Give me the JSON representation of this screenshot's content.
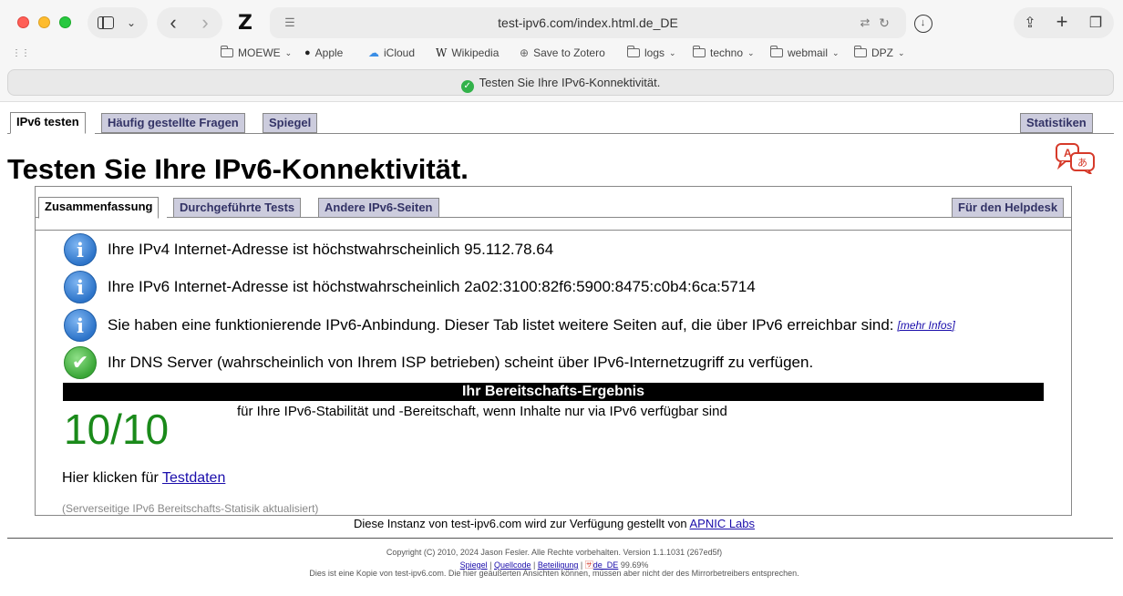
{
  "browser": {
    "url": "test-ipv6.com/index.html.de_DE",
    "tab_title": "Testen Sie Ihre IPv6-Konnektivität.",
    "bookmarks": [
      {
        "label": "MOEWE",
        "icon": "folder-icon",
        "dropdown": true
      },
      {
        "label": "Apple",
        "icon": "apple-icon",
        "dropdown": false
      },
      {
        "label": "iCloud",
        "icon": "cloud-icon",
        "dropdown": false
      },
      {
        "label": "Wikipedia",
        "icon": "wikipedia-icon",
        "dropdown": false
      },
      {
        "label": "Save to Zotero",
        "icon": "globe-icon",
        "dropdown": false
      },
      {
        "label": "logs",
        "icon": "folder-icon",
        "dropdown": true
      },
      {
        "label": "techno",
        "icon": "folder-icon",
        "dropdown": true
      },
      {
        "label": "webmail",
        "icon": "folder-icon",
        "dropdown": true
      },
      {
        "label": "DPZ",
        "icon": "folder-icon",
        "dropdown": true
      }
    ]
  },
  "page": {
    "top_tabs": [
      "IPv6 testen",
      "Häufig gestellte Fragen",
      "Spiegel"
    ],
    "stats_tab": "Statistiken",
    "title": "Testen Sie Ihre IPv6-Konnektivität.",
    "sub_tabs": [
      "Zusammenfassung",
      "Durchgeführte Tests",
      "Andere IPv6-Seiten"
    ],
    "helpdesk_tab": "Für den Helpdesk",
    "results": [
      {
        "icon": "info-icon",
        "text": "Ihre IPv4 Internet-Adresse ist höchstwahrscheinlich 95.112.78.64"
      },
      {
        "icon": "info-icon",
        "text": "Ihre IPv6 Internet-Adresse ist höchstwahrscheinlich 2a02:3100:82f6:5900:8475:c0b4:6ca:5714"
      },
      {
        "icon": "info-icon",
        "text": "Sie haben eine funktionierende IPv6-Anbindung. Dieser Tab listet weitere Seiten auf, die über IPv6 erreichbar sind:",
        "link": "[mehr Infos]"
      },
      {
        "icon": "checkmark-icon",
        "text": "Ihr DNS Server (wahrscheinlich von Ihrem ISP betrieben) scheint über IPv6-Internetzugriff zu verfügen."
      }
    ],
    "score_header": "Ihr Bereitschafts-Ergebnis",
    "score": "10/10",
    "score_description": "für Ihre IPv6-Stabilität und -Bereitschaft, wenn Inhalte nur via IPv6 verfügbar sind",
    "click_prefix": "Hier klicken für ",
    "click_link": "Testdaten",
    "server_note": "(Serverseitige IPv6 Bereitschafts-Statisik aktualisiert)",
    "instance_prefix": "Diese Instanz von test-ipv6.com wird zur Verfügung gestellt von ",
    "instance_link": "APNIC Labs",
    "footer": {
      "copyright": "Copyright (C) 2010, 2024 Jason Fesler. Alle Rechte vorbehalten. Version 1.1.1031 (267ed5f)",
      "links": [
        "Spiegel",
        "Quellcode",
        "Beteiligung"
      ],
      "locale": "de_DE",
      "percent": "99.69%",
      "disclaimer": "Dies ist eine Kopie von test-ipv6.com. Die hier geäußerten Ansichten können, müssen aber nicht der des Mirrorbetreibers entsprechen."
    }
  }
}
